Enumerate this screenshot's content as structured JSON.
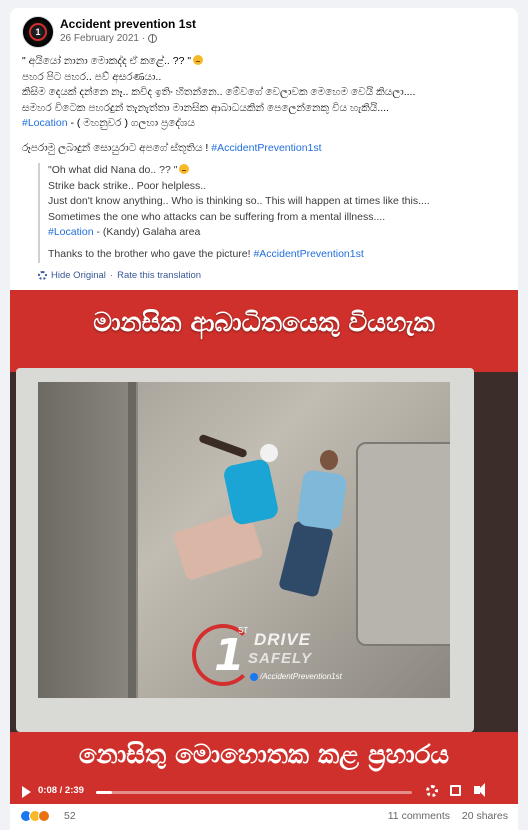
{
  "post": {
    "page_name": "Accident prevention 1st",
    "date": "26 February 2021 ·",
    "lines_si": [
      "\" අයියෝ නානා මොකද්ද ඒ කළේ.. ?? \"",
      "පහර පිට පහර.. පව් අසරණයා..",
      "කිසිම දෙයක් දන්නෙ නෑ.. කවිද ඉතිං හිතන්නෙ.. මේවගේ වෙලාවක මෙහෙම වෙයි කියලා....",
      "සමහර විටෙක පහරදුන් තැනැත්තා මානසික ආබාධයකින් පෙලෙන්නෙකු විය හැකියි....",
      "#Location - ( මහනුවර ) ගලහා ප්‍රදේශය",
      "රූපරාමු ලබාදුන් සොයුරාට අපගේ ස්තූතිය ! #AccidentPrevention1st"
    ],
    "location_tag": "#Location",
    "location_rest_si": " - ( මහනුවර ) ගලහා ප්‍රදේශය",
    "thanks_si_text": "රූපරාමු ලබාදුන් සොයුරාට අපගේ ස්තූතිය ! ",
    "hashtag": "#AccidentPrevention1st"
  },
  "translation": {
    "line1": "\"Oh what did Nana do.. ?? \"",
    "line2": "Strike back strike.. Poor helpless..",
    "line3": "Just don't know anything.. Who is thinking so.. This will happen at times like this....",
    "line4": "Sometimes the one who attacks can be suffering from a mental illness....",
    "location_tag": "#Location",
    "location_rest": " - (Kandy) Galaha area",
    "thanks_text": "Thanks to the brother who gave the picture! ",
    "hashtag": "#AccidentPrevention1st",
    "hide_original": "Hide Original",
    "rate_translation": "Rate this translation",
    "separator": "·"
  },
  "video": {
    "caption_top": "මානසික ආබාධිතයෙකු වියහැක",
    "caption_bottom": "නොසිතු මොහොතක කළ ප්‍රහාරය",
    "watermark_num": "1",
    "watermark_st": "ST",
    "watermark_drive": "DRIVE",
    "watermark_safely": "SAFELY",
    "watermark_handle": "/AccidentPrevention1st",
    "time_label": "0:08 / 2:39",
    "progress_fraction": 0.05
  },
  "footer": {
    "reaction_count": "52",
    "comments": "11 comments",
    "shares": "20 shares"
  },
  "colors": {
    "accent": "#216fdb",
    "banner_red": "#d0302b"
  }
}
